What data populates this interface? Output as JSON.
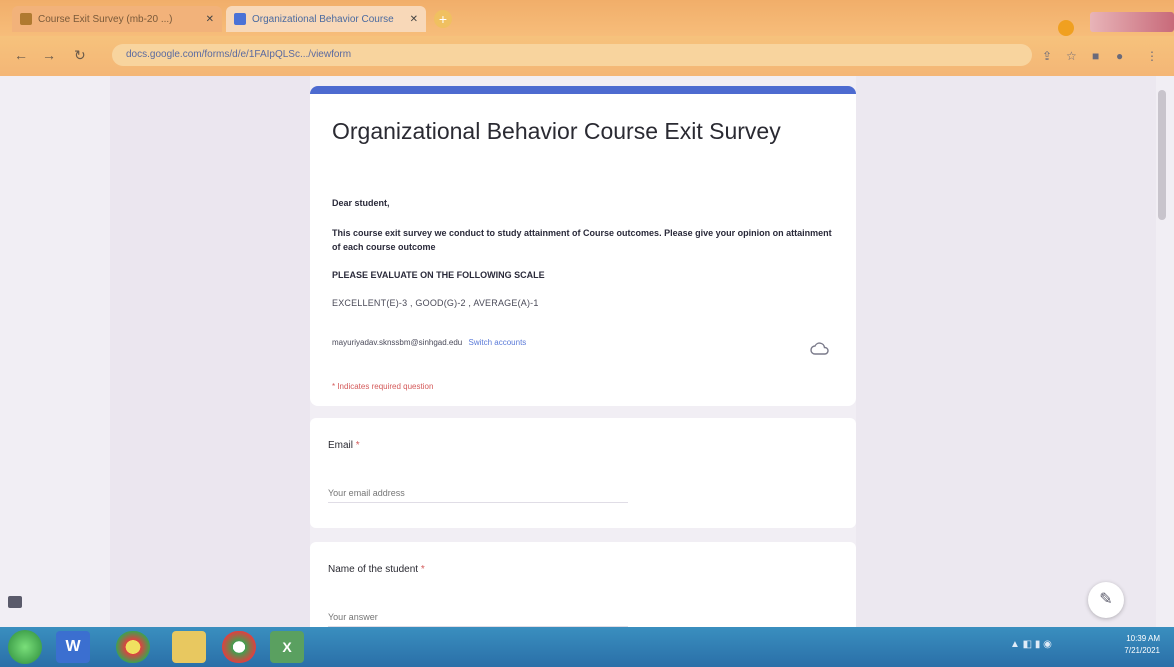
{
  "browser": {
    "tabs": [
      {
        "label": "Course Exit Survey (mb-20 ...)"
      },
      {
        "label": "Organizational Behavior Course"
      }
    ],
    "new_tab_label": "+",
    "url": "docs.google.com/forms/d/e/1FAIpQLSc.../viewform"
  },
  "form": {
    "title": "Organizational Behavior Course Exit Survey",
    "greeting": "Dear student,",
    "intro": "This course exit survey we conduct to study attainment of Course outcomes. Please give your opinion on attainment of each course outcome",
    "scale_heading": "PLEASE EVALUATE ON THE FOLLOWING SCALE",
    "scale_values": "EXCELLENT(E)-3 , GOOD(G)-2 , AVERAGE(A)-1",
    "account_email": "mayuriyadav.sknssbm@sinhgad.edu",
    "switch_accounts": "Switch accounts",
    "required_note": "* Indicates required question"
  },
  "questions": [
    {
      "label": "Email",
      "required_mark": " *",
      "placeholder": "Your email address"
    },
    {
      "label": "Name of the student",
      "required_mark": " *",
      "placeholder": "Your answer"
    }
  ],
  "taskbar": {
    "word_label": "W",
    "excel_label": "X",
    "clock_time": "10:39 AM",
    "clock_date": "7/21/2021"
  },
  "colors": {
    "form_accent": "#4d6bd0",
    "required": "#d45a5a",
    "link": "#5a7ad8"
  }
}
